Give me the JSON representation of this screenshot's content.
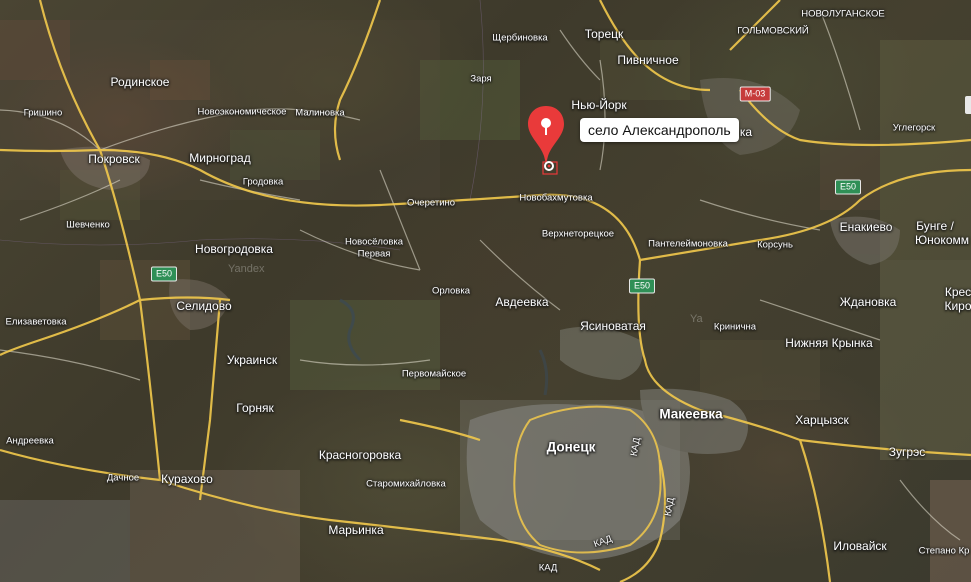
{
  "map": {
    "provider": "Yandex",
    "style": "satellite"
  },
  "marker": {
    "label": "село Александрополь",
    "color": "#e93a3a"
  },
  "places": {
    "rodinskoe": "Родинское",
    "grishino": "Гришино",
    "novoekonomicheskoe": "Новоэкономическое",
    "malinovka": "Малиновка",
    "scherbinovka": "Щербиновка",
    "toretsk": "Торецк",
    "golmovsky": "ГОЛЬМОВСКИЙ",
    "novolugansk": "НОВОЛУГАНСКОЕ",
    "zarya": "Заря",
    "pivnichnoe": "Пивничное",
    "newyork": "Нью-Йорк",
    "gorlovka_tail": "ка",
    "uglegorsk": "Углегорск",
    "pokrovsk": "Покровск",
    "mirnograd": "Мирноград",
    "grodovka": "Гродовка",
    "ocheretino": "Очеретино",
    "novobakhmutovka": "Новобахмутовка",
    "shevchenko": "Шевченко",
    "verkhnetoretskoe": "Верхнеторецкое",
    "novogrodovka": "Новогродовка",
    "novoselovka": "Новосёловка",
    "pervaya": "Первая",
    "panteleimonovka": "Пантелеймоновка",
    "korsun": "Корсунь",
    "enakievo": "Енакиево",
    "bunge": "Бунге /",
    "yunokommunarovsk": "Юнокомм",
    "selidovo": "Селидово",
    "orlovka": "Орловка",
    "avdeevka": "Авдеевка",
    "yasinovataya": "Ясиноватая",
    "krinichnaya": "Кринична",
    "zhdanovka": "Ждановка",
    "krest": "Крес",
    "kirov": "Киро",
    "elizavetovka": "Елизаветовка",
    "ukrainsk": "Украинск",
    "pervomaiskoe": "Первомайское",
    "nizhnyaya_krynka": "Нижняя Крынка",
    "gornyak": "Горняк",
    "makeevka": "Макеевка",
    "khartsyzsk": "Харцызск",
    "andreevka": "Андреевка",
    "donetsk": "Донецк",
    "krasnogorovka": "Красногоровка",
    "zugres": "Зугрэс",
    "dachnoe": "Дачное",
    "kurakhovo": "Курахово",
    "staromikhaylovka": "Старомихайловка",
    "marinka": "Марьинка",
    "ilovaysk": "Иловайск",
    "stepano": "Степано Кр"
  },
  "roads": {
    "e50_a": "E50",
    "e50_b": "E50",
    "e50_c": "E50",
    "m03": "M-03",
    "kad1": "КАД",
    "kad2": "КАД",
    "kad3": "КАД",
    "kad4": "КАД"
  },
  "watermark": "Yandex",
  "watermark2": "Ya"
}
